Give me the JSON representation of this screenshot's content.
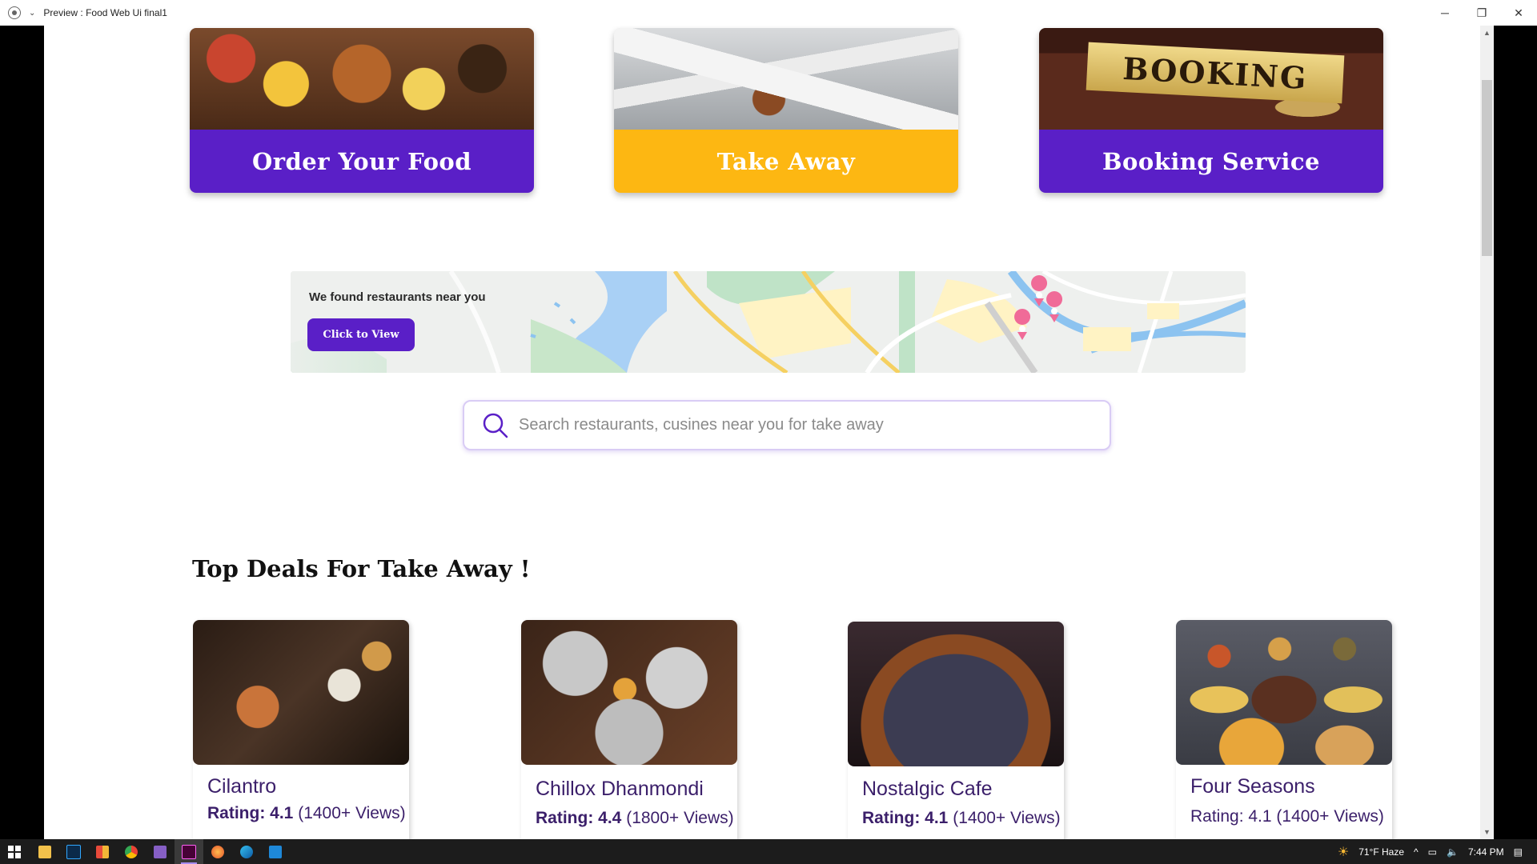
{
  "window": {
    "title": "Preview : Food Web Ui final1",
    "controls": {
      "minimize": "─",
      "restore": "❐",
      "close": "✕"
    }
  },
  "services": [
    {
      "label": "Order Your Food",
      "color": "#5a1fc7"
    },
    {
      "label": "Take Away",
      "color": "#fdb712"
    },
    {
      "label": "Booking Service",
      "color": "#5a1fc7"
    }
  ],
  "booking_sign": "BOOKING",
  "map_banner": {
    "message": "We found restaurants near you",
    "button_label": "Click to View"
  },
  "search": {
    "placeholder": "Search restaurants, cusines near you for take away"
  },
  "section_title": "Top Deals For Take Away !",
  "deals": [
    {
      "name": "Cilantro",
      "rating_label": "Rating: 4.1",
      "views": "(1400+ Views)"
    },
    {
      "name": "Chillox Dhanmondi",
      "rating_label": "Rating: 4.4",
      "views": "(1800+ Views)"
    },
    {
      "name": "Nostalgic Cafe",
      "rating_label": "Rating: 4.1",
      "views": "(1400+ Views)"
    },
    {
      "name": "Four Seasons",
      "rating_label": "Rating: 4.1",
      "views": "(1400+ Views)"
    }
  ],
  "taskbar": {
    "weather": "71°F  Haze",
    "time": "7:44 PM",
    "apps": [
      "windows-start",
      "file-explorer",
      "photoshop",
      "app-grid",
      "chrome",
      "visual-studio",
      "adobe-xd",
      "firefox",
      "edge",
      "vscode"
    ]
  },
  "colors": {
    "accent": "#5a1fc7",
    "amber": "#fdb712",
    "text_dark": "#3b1f6a"
  }
}
